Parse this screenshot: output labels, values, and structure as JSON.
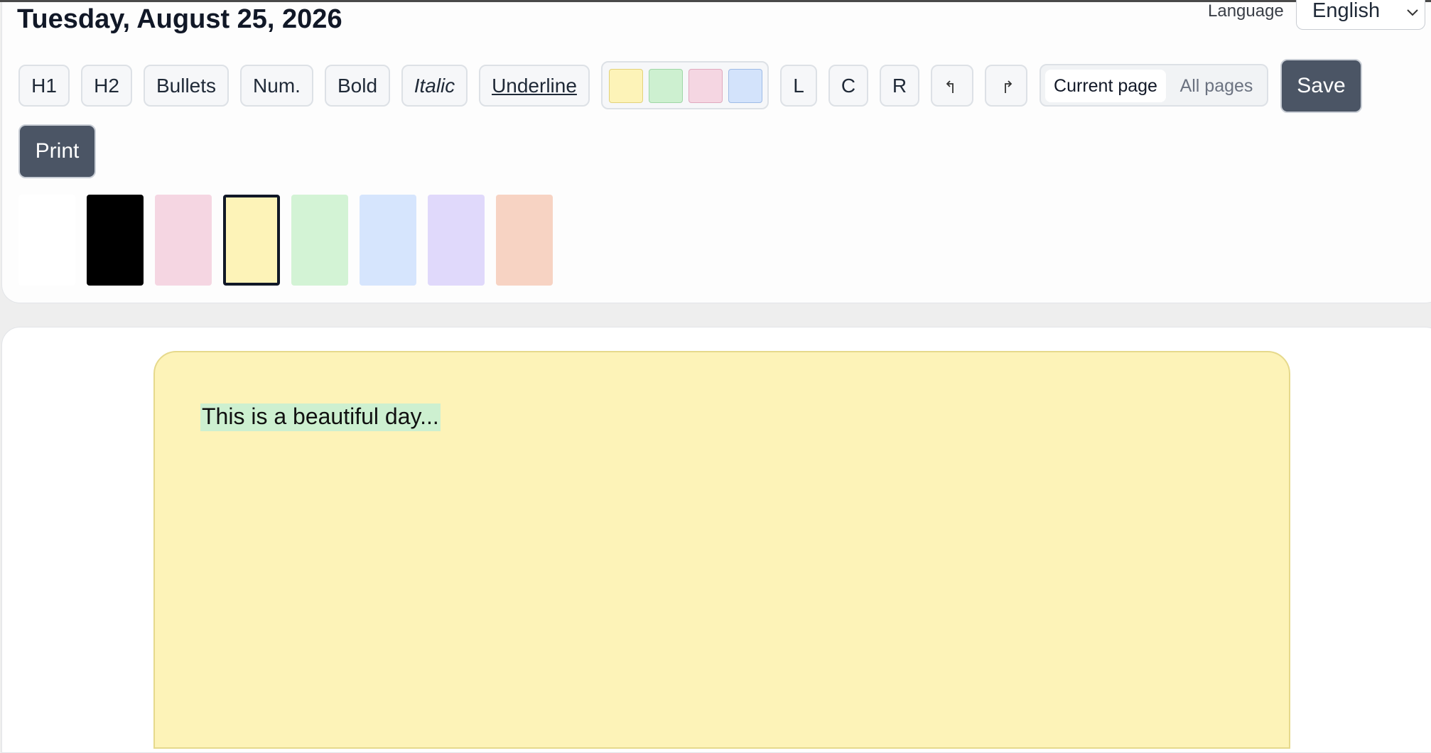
{
  "header": {
    "date": "Tuesday, August 25, 2026",
    "language_label": "Language",
    "language_value": "English"
  },
  "toolbar": {
    "h1": "H1",
    "h2": "H2",
    "bullets": "Bullets",
    "numbered": "Num.",
    "bold": "Bold",
    "italic": "Italic",
    "underline": "Underline",
    "align_left": "L",
    "align_center": "C",
    "align_right": "R",
    "scope_current": "Current page",
    "scope_all": "All pages",
    "save": "Save",
    "print": "Print"
  },
  "highlight_colors": [
    "#fdf3b8",
    "#cdf0d0",
    "#f5d6e2",
    "#d3e3fb"
  ],
  "page_colors": [
    "#ffffff",
    "#000000",
    "#f5d6e2",
    "#fdf3b8",
    "#d3f3d5",
    "#d6e5fd",
    "#e0d9fb",
    "#f7d3c3"
  ],
  "selected_page_color_index": 3,
  "editor": {
    "text": "This is a beautiful day..."
  },
  "icons": {
    "undo": "undo-icon",
    "redo": "redo-icon",
    "language_dropdown": "chevron-down-icon"
  }
}
